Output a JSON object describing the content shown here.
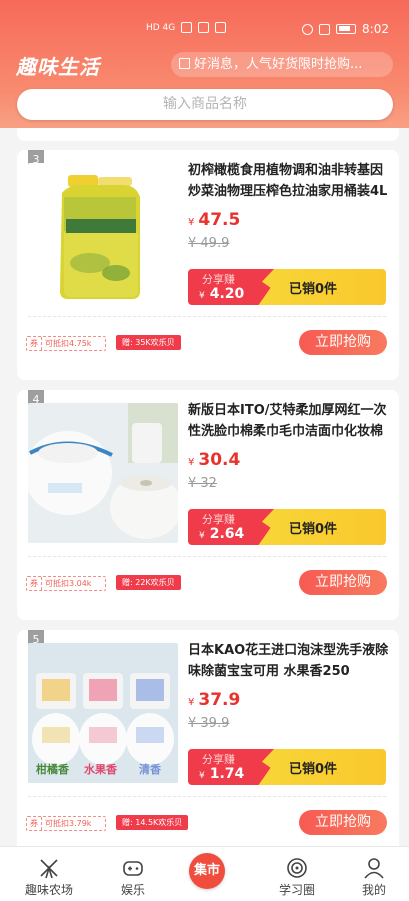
{
  "status_bar": {
    "left_text": "HD 4G",
    "time": "8:02"
  },
  "header": {
    "app_title": "趣味生活",
    "notice": "好消息，人气好货限时抢购...",
    "search_placeholder": "输入商品名称"
  },
  "products": [
    {
      "rank": "3",
      "title": "初榨橄榄食用植物调和油非转基因炒菜油物理压榨色拉油家用桶装4L",
      "currency": "¥",
      "price": "47.5",
      "original_price": "¥ 49.9",
      "share_label": "分享赚",
      "share_amount": "4.20",
      "sold": "已销0件",
      "coupon_tag": "券",
      "coupon_text": "可抵扣4.75k",
      "gift": "赠: 35K欢乐贝",
      "buy_label": "立即抢购",
      "image": "olive-oil-bottle"
    },
    {
      "rank": "4",
      "title": "新版日本ITO/艾特柔加厚网红一次性洗脸巾棉柔巾毛巾洁面巾化妆棉",
      "currency": "¥",
      "price": "30.4",
      "original_price": "¥ 32",
      "share_label": "分享赚",
      "share_amount": "2.64",
      "sold": "已销0件",
      "coupon_tag": "券",
      "coupon_text": "可抵扣3.04k",
      "gift": "赠: 22K欢乐贝",
      "buy_label": "立即抢购",
      "image": "face-towel-rolls"
    },
    {
      "rank": "5",
      "title": "日本KAO花王进口泡沫型洗手液除味除菌宝宝可用 水果香250",
      "currency": "¥",
      "price": "37.9",
      "original_price": "¥ 39.9",
      "share_label": "分享赚",
      "share_amount": "1.74",
      "sold": "已销0件",
      "coupon_tag": "券",
      "coupon_text": "可抵扣3.79k",
      "gift": "赠: 14.5K欢乐贝",
      "buy_label": "立即抢购",
      "image": "hand-soap-bottles",
      "bottle_labels": [
        "柑橘香",
        "水果香",
        "清香"
      ]
    }
  ],
  "tabbar": {
    "farm": "趣味农场",
    "fun": "娱乐",
    "market": "集市",
    "study": "学习圈",
    "mine": "我的"
  },
  "colors": {
    "brand_red": "#f04d3e",
    "price_red": "#e8322c",
    "share_yellow": "#f8dd40"
  }
}
